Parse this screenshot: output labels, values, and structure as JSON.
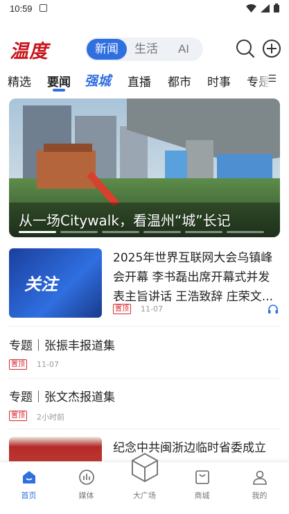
{
  "status_bar": {
    "time": "10:59"
  },
  "header": {
    "logo_text": "温度",
    "segments": [
      "新闻",
      "生活",
      "AI"
    ],
    "active_segment": "新闻"
  },
  "tabs": [
    {
      "label": "精选"
    },
    {
      "label": "要闻"
    },
    {
      "label": "强城"
    },
    {
      "label": "直播"
    },
    {
      "label": "都市"
    },
    {
      "label": "时事"
    },
    {
      "label": "专是"
    }
  ],
  "banner": {
    "title": "从一场Citywalk，看温州“城”长记"
  },
  "news": [
    {
      "thumb_text": "关注",
      "title": "2025年世界互联网大会乌镇峰会开幕 李书磊出席开幕式并发表主旨讲话 王浩致辞 庄荣文...",
      "tag": "置顶",
      "date": "11-07"
    }
  ],
  "topics": [
    {
      "title": "专题｜张振丰报道集",
      "tag": "置顶",
      "date": "11-07"
    },
    {
      "title": "专题｜张文杰报道集",
      "tag": "置顶",
      "date": "2小时前"
    }
  ],
  "partial_news": {
    "title": "纪念中共闽浙边临时省委成立暨..."
  },
  "bottom_nav": [
    {
      "label": "首页"
    },
    {
      "label": "媒体"
    },
    {
      "label": "大广场"
    },
    {
      "label": "商城"
    },
    {
      "label": "我的"
    }
  ],
  "colors": {
    "accent": "#2f6fe0",
    "brand_red": "#c8161e",
    "tag_red": "#d8282f"
  }
}
